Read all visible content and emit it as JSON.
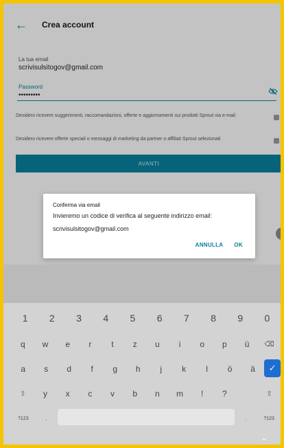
{
  "screen": {
    "title": "Crea account"
  },
  "form": {
    "email_label": "La tua email",
    "email_value": "scrivisulsitogov@gmail.com",
    "password_label": "Password",
    "password_value": "•••••••••",
    "marketing_checkbox_text": "Desidero ricevere suggerimenti, raccomandazioni, offerte e aggiornamenti sui prodotti Sprout via e-mail",
    "partners_checkbox_text": "Desidero ricevere offerte speciali o messaggi di marketing da partner o affiliati Sprout selezionati",
    "submit_label": "AVANTI"
  },
  "dialog": {
    "title": "Conferma via email",
    "message": "Invieremo un codice di verifica al seguente indirizzo email:",
    "email": "scrivisulsitogov@gmail.com",
    "cancel_label": "ANNULLA",
    "ok_label": "OK"
  },
  "keyboard": {
    "numbers": [
      "1",
      "2",
      "3",
      "4",
      "5",
      "6",
      "7",
      "8",
      "9",
      "0"
    ],
    "row2": [
      "q",
      "w",
      "e",
      "r",
      "t",
      "z",
      "u",
      "i",
      "o",
      "p",
      "ü"
    ],
    "row3": [
      "a",
      "s",
      "d",
      "f",
      "g",
      "h",
      "j",
      "k",
      "l",
      "ö",
      "ä"
    ],
    "row4": [
      "y",
      "x",
      "c",
      "v",
      "b",
      "n",
      "m",
      "!",
      "?"
    ],
    "symbols_label": "?123",
    "comma_label": ",",
    "period_label": "."
  },
  "icons": {
    "back": "arrow-left",
    "password_toggle": "eye-off",
    "backspace": "backspace",
    "enter": "check",
    "shift": "shift-up",
    "collapse": "chevron-down"
  },
  "colors": {
    "accent": "#0a7f9c",
    "enter_key": "#1e6ed2",
    "frame": "#f5c400"
  }
}
